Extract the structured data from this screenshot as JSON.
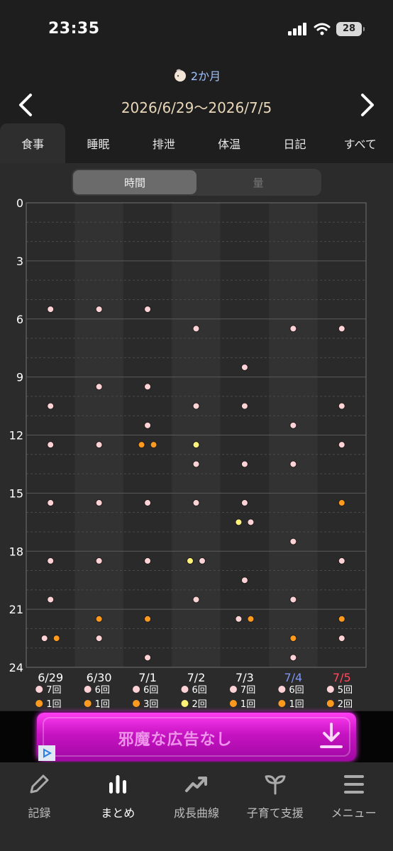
{
  "status": {
    "time": "23:35",
    "battery": "28"
  },
  "header": {
    "age_label": "2か月",
    "date_range": "2026/6/29〜2026/7/5"
  },
  "tabs": [
    "食事",
    "睡眠",
    "排泄",
    "体温",
    "日記",
    "すべて"
  ],
  "active_tab": 0,
  "segments": [
    "時間",
    "量"
  ],
  "active_segment": 0,
  "chart_data": {
    "type": "scatter",
    "y_axis": {
      "reversed": true,
      "range": [
        0,
        24
      ],
      "ticks": [
        0,
        3,
        6,
        9,
        12,
        15,
        18,
        21,
        24
      ]
    },
    "categories": [
      "6/29",
      "6/30",
      "7/1",
      "7/2",
      "7/3",
      "7/4",
      "7/5"
    ],
    "category_colors": [
      "#ffffff",
      "#ffffff",
      "#ffffff",
      "#ffffff",
      "#ffffff",
      "#7f95ef",
      "#ff4a5e"
    ],
    "series": [
      {
        "key": "pink",
        "color": "#ffd3d6",
        "points": [
          {
            "day": 0,
            "hour": 5.5
          },
          {
            "day": 0,
            "hour": 10.5
          },
          {
            "day": 0,
            "hour": 12.5
          },
          {
            "day": 0,
            "hour": 15.5
          },
          {
            "day": 0,
            "hour": 18.5
          },
          {
            "day": 0,
            "hour": 20.5
          },
          {
            "day": 0,
            "hour": 22.5,
            "offset": -1
          },
          {
            "day": 1,
            "hour": 5.5
          },
          {
            "day": 1,
            "hour": 9.5
          },
          {
            "day": 1,
            "hour": 12.5
          },
          {
            "day": 1,
            "hour": 15.5
          },
          {
            "day": 1,
            "hour": 18.5
          },
          {
            "day": 1,
            "hour": 22.5
          },
          {
            "day": 2,
            "hour": 5.5
          },
          {
            "day": 2,
            "hour": 9.5
          },
          {
            "day": 2,
            "hour": 11.5
          },
          {
            "day": 2,
            "hour": 15.5
          },
          {
            "day": 2,
            "hour": 18.5
          },
          {
            "day": 2,
            "hour": 23.5
          },
          {
            "day": 3,
            "hour": 6.5
          },
          {
            "day": 3,
            "hour": 10.5
          },
          {
            "day": 3,
            "hour": 13.5
          },
          {
            "day": 3,
            "hour": 15.5
          },
          {
            "day": 3,
            "hour": 18.5,
            "offset": 1
          },
          {
            "day": 3,
            "hour": 20.5
          },
          {
            "day": 4,
            "hour": 8.5
          },
          {
            "day": 4,
            "hour": 10.5
          },
          {
            "day": 4,
            "hour": 13.5
          },
          {
            "day": 4,
            "hour": 15.5
          },
          {
            "day": 4,
            "hour": 16.5,
            "offset": 1
          },
          {
            "day": 4,
            "hour": 19.5
          },
          {
            "day": 4,
            "hour": 21.5,
            "offset": -1
          },
          {
            "day": 5,
            "hour": 6.5
          },
          {
            "day": 5,
            "hour": 11.5
          },
          {
            "day": 5,
            "hour": 13.5
          },
          {
            "day": 5,
            "hour": 17.5
          },
          {
            "day": 5,
            "hour": 20.5
          },
          {
            "day": 5,
            "hour": 23.5
          },
          {
            "day": 6,
            "hour": 6.5
          },
          {
            "day": 6,
            "hour": 10.5
          },
          {
            "day": 6,
            "hour": 12.5
          },
          {
            "day": 6,
            "hour": 18.5
          },
          {
            "day": 6,
            "hour": 22.5
          }
        ]
      },
      {
        "key": "orange",
        "color": "#ff9a1f",
        "points": [
          {
            "day": 0,
            "hour": 22.5,
            "offset": 1
          },
          {
            "day": 1,
            "hour": 21.5
          },
          {
            "day": 2,
            "hour": 12.5,
            "offset": -1
          },
          {
            "day": 2,
            "hour": 12.5,
            "offset": 1
          },
          {
            "day": 2,
            "hour": 21.5
          },
          {
            "day": 4,
            "hour": 21.5,
            "offset": 1
          },
          {
            "day": 5,
            "hour": 22.5
          },
          {
            "day": 6,
            "hour": 15.5
          },
          {
            "day": 6,
            "hour": 21.5
          }
        ]
      },
      {
        "key": "yellow",
        "color": "#fff27a",
        "points": [
          {
            "day": 3,
            "hour": 12.5
          },
          {
            "day": 3,
            "hour": 18.5,
            "offset": -1
          },
          {
            "day": 4,
            "hour": 16.5,
            "offset": -1
          }
        ]
      }
    ],
    "summary": [
      [
        {
          "color": "#ffd3d6",
          "text": "7回"
        },
        {
          "color": "#ff9a1f",
          "text": "1回"
        }
      ],
      [
        {
          "color": "#ffd3d6",
          "text": "6回"
        },
        {
          "color": "#ff9a1f",
          "text": "1回"
        }
      ],
      [
        {
          "color": "#ffd3d6",
          "text": "6回"
        },
        {
          "color": "#ff9a1f",
          "text": "3回"
        }
      ],
      [
        {
          "color": "#ffd3d6",
          "text": "6回"
        },
        {
          "color": "#fff27a",
          "text": "2回"
        }
      ],
      [
        {
          "color": "#ffd3d6",
          "text": "7回"
        },
        {
          "color": "#ff9a1f",
          "text": "1回"
        }
      ],
      [
        {
          "color": "#ffd3d6",
          "text": "6回"
        },
        {
          "color": "#ff9a1f",
          "text": "1回"
        }
      ],
      [
        {
          "color": "#ffd3d6",
          "text": "5回"
        },
        {
          "color": "#ff9a1f",
          "text": "2回"
        }
      ]
    ]
  },
  "ad": {
    "text": "邪魔な広告なし"
  },
  "bottom_nav": [
    {
      "label": "記録",
      "icon": "pencil-icon"
    },
    {
      "label": "まとめ",
      "icon": "bar-chart-icon"
    },
    {
      "label": "成長曲線",
      "icon": "trend-up-icon"
    },
    {
      "label": "子育て支援",
      "icon": "sprout-icon"
    },
    {
      "label": "メニュー",
      "icon": "menu-icon"
    }
  ],
  "active_nav": 1
}
